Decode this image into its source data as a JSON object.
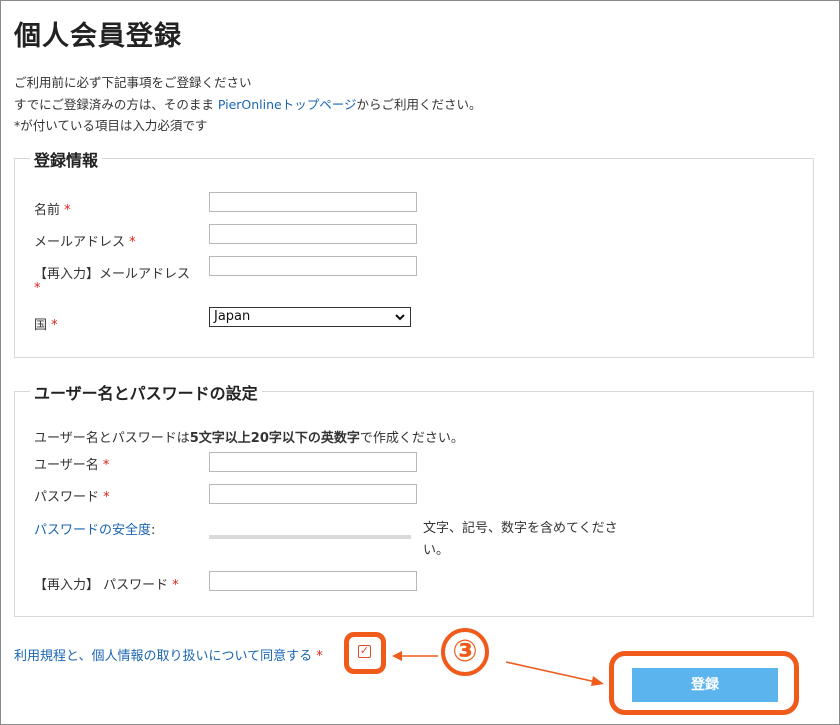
{
  "page": {
    "title": "個人会員登録",
    "intro_line1": "ご利用前に必ず下記事項をご登録ください",
    "intro_line2_prefix": "すでにご登録済みの方は、そのまま ",
    "intro_line2_link": "PierOnlineトップページ",
    "intro_line2_suffix": "からご利用ください。",
    "intro_line3": "*が付いている項目は入力必須です"
  },
  "registration": {
    "legend": "登録情報",
    "name_label": "名前",
    "email_label": "メールアドレス",
    "email_confirm_label": "【再入力】メールアドレス",
    "country_label": "国",
    "country_value": "Japan",
    "required_mark": "*"
  },
  "credentials": {
    "legend": "ユーザー名とパスワードの設定",
    "note_prefix": "ユーザー名とパスワードは",
    "note_bold": "5文字以上20字以下の英数字",
    "note_suffix": "で作成ください。",
    "username_label": "ユーザー名",
    "password_label": "パスワード",
    "strength_label": "パスワードの安全度",
    "strength_colon": ":",
    "strength_hint": "文字、記号、数字を含めてください。",
    "password_confirm_label": "【再入力】 パスワード",
    "required_mark": "*"
  },
  "agreement": {
    "link_text": "利用規程と、個人情報の取り扱い",
    "suffix": "について同意する",
    "required_mark": "*",
    "checked_glyph": "✓"
  },
  "submit": {
    "label": "登録"
  },
  "annotation": {
    "step_number": "③",
    "highlight_color": "#f05a1a"
  }
}
